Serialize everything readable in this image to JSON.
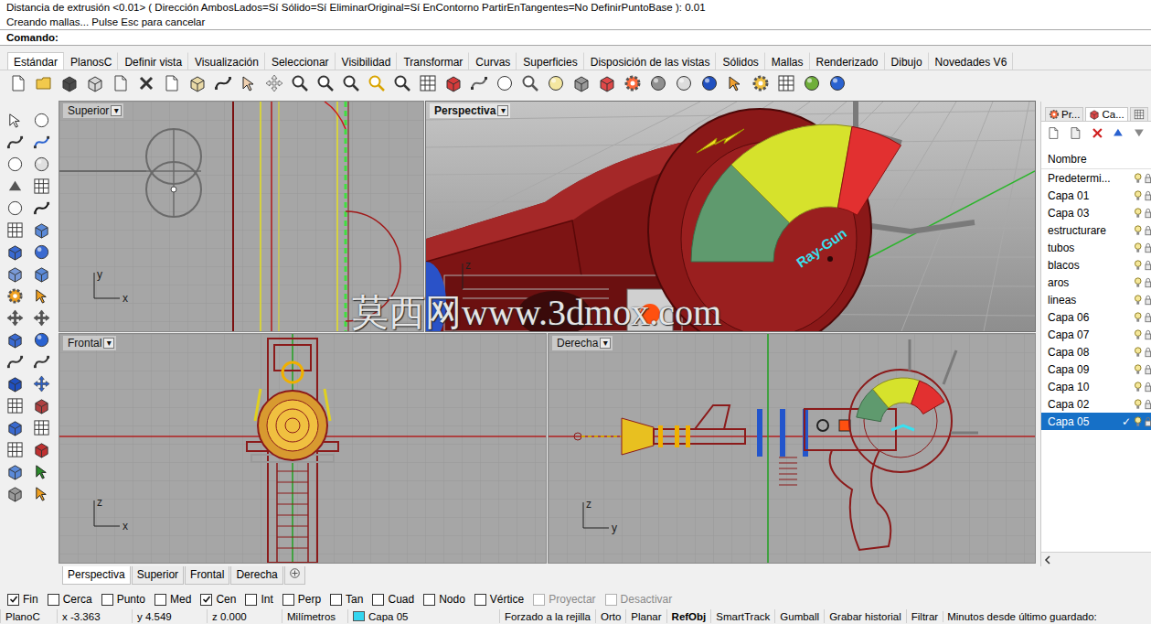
{
  "command": {
    "history": [
      "Distancia de extrusión <0.01> ( Dirección  AmbosLados=Sí  Sólido=Sí  EliminarOriginal=Sí  EnContorno  PartirEnTangentes=No  DefinirPuntoBase ): 0.01",
      "Creando mallas... Pulse Esc para cancelar"
    ],
    "prompt": "Comando:"
  },
  "toolbar_tabs": [
    {
      "label": "Estándar",
      "selected": true
    },
    {
      "label": "PlanosC",
      "selected": false
    },
    {
      "label": "Definir vista",
      "selected": false
    },
    {
      "label": "Visualización",
      "selected": false
    },
    {
      "label": "Seleccionar",
      "selected": false
    },
    {
      "label": "Visibilidad",
      "selected": false
    },
    {
      "label": "Transformar",
      "selected": false
    },
    {
      "label": "Curvas",
      "selected": false
    },
    {
      "label": "Superficies",
      "selected": false
    },
    {
      "label": "Disposición de las vistas",
      "selected": false
    },
    {
      "label": "Sólidos",
      "selected": false
    },
    {
      "label": "Mallas",
      "selected": false
    },
    {
      "label": "Renderizado",
      "selected": false
    },
    {
      "label": "Dibujo",
      "selected": false
    },
    {
      "label": "Novedades V6",
      "selected": false
    }
  ],
  "dropdown": "▾",
  "viewports": [
    {
      "title": "Superior",
      "kind": "top",
      "active": false,
      "axes": [
        "y",
        "x"
      ]
    },
    {
      "title": "Perspectiva",
      "kind": "perspective",
      "active": true,
      "axes": [
        "z"
      ],
      "model_text": "Ray-Gun"
    },
    {
      "title": "Frontal",
      "kind": "front",
      "active": false,
      "axes": [
        "z",
        "x"
      ]
    },
    {
      "title": "Derecha",
      "kind": "right",
      "active": false,
      "axes": [
        "z",
        "y"
      ]
    }
  ],
  "watermark": "莫西网www.3dmox.com",
  "viewport_tabs": [
    {
      "label": "Perspectiva",
      "selected": true
    },
    {
      "label": "Superior",
      "selected": false
    },
    {
      "label": "Frontal",
      "selected": false
    },
    {
      "label": "Derecha",
      "selected": false
    }
  ],
  "layers_panel": {
    "tabs": [
      {
        "label": "Pr...",
        "selected": false
      },
      {
        "label": "Ca...",
        "selected": true
      }
    ],
    "column": "Nombre",
    "check": "✓",
    "layers": [
      {
        "name": "Predetermi...",
        "selected": false,
        "current": false
      },
      {
        "name": "Capa 01",
        "selected": false,
        "current": false
      },
      {
        "name": "Capa 03",
        "selected": false,
        "current": false
      },
      {
        "name": "estructurare",
        "selected": false,
        "current": false
      },
      {
        "name": "tubos",
        "selected": false,
        "current": false
      },
      {
        "name": "blacos",
        "selected": false,
        "current": false
      },
      {
        "name": "aros",
        "selected": false,
        "current": false
      },
      {
        "name": "lineas",
        "selected": false,
        "current": false
      },
      {
        "name": "Capa 06",
        "selected": false,
        "current": false
      },
      {
        "name": "Capa 07",
        "selected": false,
        "current": false
      },
      {
        "name": "Capa 08",
        "selected": false,
        "current": false
      },
      {
        "name": "Capa 09",
        "selected": false,
        "current": false
      },
      {
        "name": "Capa 10",
        "selected": false,
        "current": false
      },
      {
        "name": "Capa 02",
        "selected": false,
        "current": false
      },
      {
        "name": "Capa 05",
        "selected": true,
        "current": true
      }
    ]
  },
  "osnaps": [
    {
      "label": "Fin",
      "checked": true,
      "disabled": false
    },
    {
      "label": "Cerca",
      "checked": false,
      "disabled": false
    },
    {
      "label": "Punto",
      "checked": false,
      "disabled": false
    },
    {
      "label": "Med",
      "checked": false,
      "disabled": false
    },
    {
      "label": "Cen",
      "checked": true,
      "disabled": false
    },
    {
      "label": "Int",
      "checked": false,
      "disabled": false
    },
    {
      "label": "Perp",
      "checked": false,
      "disabled": false
    },
    {
      "label": "Tan",
      "checked": false,
      "disabled": false
    },
    {
      "label": "Cuad",
      "checked": false,
      "disabled": false
    },
    {
      "label": "Nodo",
      "checked": false,
      "disabled": false
    },
    {
      "label": "Vértice",
      "checked": false,
      "disabled": false
    },
    {
      "label": "Proyectar",
      "checked": false,
      "disabled": true
    },
    {
      "label": "Desactivar",
      "checked": false,
      "disabled": true
    }
  ],
  "status_bar": {
    "plane": "PlanoC",
    "x": "x -3.363",
    "y": "y 4.549",
    "z": "z 0.000",
    "units": "Milímetros",
    "layer": {
      "name": "Capa 05",
      "color": "#33d6f0"
    },
    "toggles": [
      {
        "label": "Forzado a la rejilla",
        "on": false
      },
      {
        "label": "Orto",
        "on": false
      },
      {
        "label": "Planar",
        "on": false
      },
      {
        "label": "RefObj",
        "on": true
      },
      {
        "label": "SmartTrack",
        "on": false
      },
      {
        "label": "Gumball",
        "on": false
      },
      {
        "label": "Grabar historial",
        "on": false
      },
      {
        "label": "Filtrar",
        "on": false
      }
    ],
    "save_info": "Minutos desde último guardado:"
  }
}
